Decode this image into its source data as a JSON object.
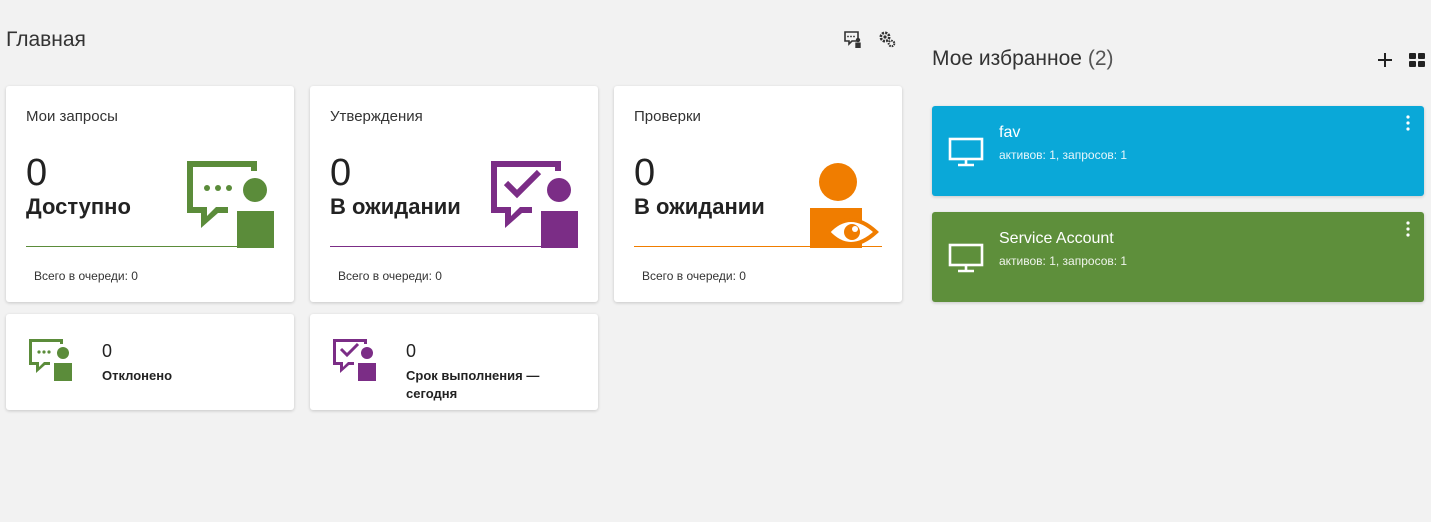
{
  "header": {
    "title": "Главная",
    "icons": [
      "chat-person-icon",
      "gears-icon"
    ]
  },
  "cards": [
    {
      "label": "Мои запросы",
      "count": "0",
      "status": "Доступно",
      "queue": "Всего в очереди: 0",
      "color": "#5b8c3a",
      "icon": "chat-person-icon"
    },
    {
      "label": "Утверждения",
      "count": "0",
      "status": "В ожидании",
      "queue": "Всего в очереди: 0",
      "color": "#7b2d86",
      "icon": "approval-person-icon"
    },
    {
      "label": "Проверки",
      "count": "0",
      "status": "В ожидании",
      "queue": "Всего в очереди: 0",
      "color": "#f07d00",
      "icon": "person-eye-icon"
    }
  ],
  "small_cards": [
    {
      "count": "0",
      "label": "Отклонено",
      "color": "#5b8c3a",
      "icon": "chat-person-icon"
    },
    {
      "count": "0",
      "label": "Срок выполнения — сегодня",
      "color": "#7b2d86",
      "icon": "approval-person-icon"
    }
  ],
  "favorites": {
    "title": "Мое избранное",
    "count": "(2)",
    "actions": [
      "plus-icon",
      "grid-icon"
    ],
    "items": [
      {
        "name": "fav",
        "subtitle": "активов: 1, запросов: 1",
        "color": "#0aa8d8",
        "icon": "monitor-icon"
      },
      {
        "name": "Service Account",
        "subtitle": "активов: 1, запросов: 1",
        "color": "#5e8f3b",
        "icon": "monitor-icon"
      }
    ]
  }
}
